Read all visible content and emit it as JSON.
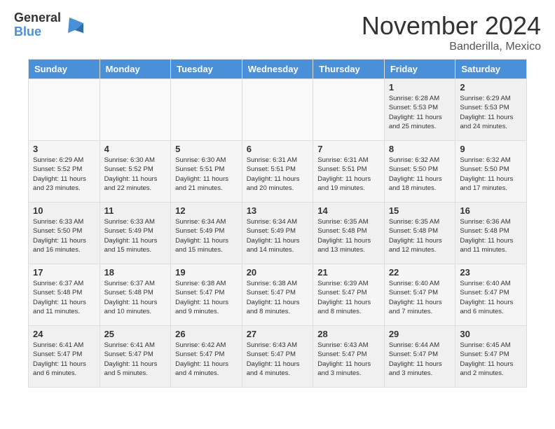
{
  "logo": {
    "general": "General",
    "blue": "Blue"
  },
  "header": {
    "month": "November 2024",
    "location": "Banderilla, Mexico"
  },
  "weekdays": [
    "Sunday",
    "Monday",
    "Tuesday",
    "Wednesday",
    "Thursday",
    "Friday",
    "Saturday"
  ],
  "weeks": [
    [
      {
        "day": "",
        "empty": true
      },
      {
        "day": "",
        "empty": true
      },
      {
        "day": "",
        "empty": true
      },
      {
        "day": "",
        "empty": true
      },
      {
        "day": "",
        "empty": true
      },
      {
        "day": "1",
        "sunrise": "Sunrise: 6:28 AM",
        "sunset": "Sunset: 5:53 PM",
        "daylight": "Daylight: 11 hours and 25 minutes."
      },
      {
        "day": "2",
        "sunrise": "Sunrise: 6:29 AM",
        "sunset": "Sunset: 5:53 PM",
        "daylight": "Daylight: 11 hours and 24 minutes."
      }
    ],
    [
      {
        "day": "3",
        "sunrise": "Sunrise: 6:29 AM",
        "sunset": "Sunset: 5:52 PM",
        "daylight": "Daylight: 11 hours and 23 minutes."
      },
      {
        "day": "4",
        "sunrise": "Sunrise: 6:30 AM",
        "sunset": "Sunset: 5:52 PM",
        "daylight": "Daylight: 11 hours and 22 minutes."
      },
      {
        "day": "5",
        "sunrise": "Sunrise: 6:30 AM",
        "sunset": "Sunset: 5:51 PM",
        "daylight": "Daylight: 11 hours and 21 minutes."
      },
      {
        "day": "6",
        "sunrise": "Sunrise: 6:31 AM",
        "sunset": "Sunset: 5:51 PM",
        "daylight": "Daylight: 11 hours and 20 minutes."
      },
      {
        "day": "7",
        "sunrise": "Sunrise: 6:31 AM",
        "sunset": "Sunset: 5:51 PM",
        "daylight": "Daylight: 11 hours and 19 minutes."
      },
      {
        "day": "8",
        "sunrise": "Sunrise: 6:32 AM",
        "sunset": "Sunset: 5:50 PM",
        "daylight": "Daylight: 11 hours and 18 minutes."
      },
      {
        "day": "9",
        "sunrise": "Sunrise: 6:32 AM",
        "sunset": "Sunset: 5:50 PM",
        "daylight": "Daylight: 11 hours and 17 minutes."
      }
    ],
    [
      {
        "day": "10",
        "sunrise": "Sunrise: 6:33 AM",
        "sunset": "Sunset: 5:50 PM",
        "daylight": "Daylight: 11 hours and 16 minutes."
      },
      {
        "day": "11",
        "sunrise": "Sunrise: 6:33 AM",
        "sunset": "Sunset: 5:49 PM",
        "daylight": "Daylight: 11 hours and 15 minutes."
      },
      {
        "day": "12",
        "sunrise": "Sunrise: 6:34 AM",
        "sunset": "Sunset: 5:49 PM",
        "daylight": "Daylight: 11 hours and 15 minutes."
      },
      {
        "day": "13",
        "sunrise": "Sunrise: 6:34 AM",
        "sunset": "Sunset: 5:49 PM",
        "daylight": "Daylight: 11 hours and 14 minutes."
      },
      {
        "day": "14",
        "sunrise": "Sunrise: 6:35 AM",
        "sunset": "Sunset: 5:48 PM",
        "daylight": "Daylight: 11 hours and 13 minutes."
      },
      {
        "day": "15",
        "sunrise": "Sunrise: 6:35 AM",
        "sunset": "Sunset: 5:48 PM",
        "daylight": "Daylight: 11 hours and 12 minutes."
      },
      {
        "day": "16",
        "sunrise": "Sunrise: 6:36 AM",
        "sunset": "Sunset: 5:48 PM",
        "daylight": "Daylight: 11 hours and 11 minutes."
      }
    ],
    [
      {
        "day": "17",
        "sunrise": "Sunrise: 6:37 AM",
        "sunset": "Sunset: 5:48 PM",
        "daylight": "Daylight: 11 hours and 11 minutes."
      },
      {
        "day": "18",
        "sunrise": "Sunrise: 6:37 AM",
        "sunset": "Sunset: 5:48 PM",
        "daylight": "Daylight: 11 hours and 10 minutes."
      },
      {
        "day": "19",
        "sunrise": "Sunrise: 6:38 AM",
        "sunset": "Sunset: 5:47 PM",
        "daylight": "Daylight: 11 hours and 9 minutes."
      },
      {
        "day": "20",
        "sunrise": "Sunrise: 6:38 AM",
        "sunset": "Sunset: 5:47 PM",
        "daylight": "Daylight: 11 hours and 8 minutes."
      },
      {
        "day": "21",
        "sunrise": "Sunrise: 6:39 AM",
        "sunset": "Sunset: 5:47 PM",
        "daylight": "Daylight: 11 hours and 8 minutes."
      },
      {
        "day": "22",
        "sunrise": "Sunrise: 6:40 AM",
        "sunset": "Sunset: 5:47 PM",
        "daylight": "Daylight: 11 hours and 7 minutes."
      },
      {
        "day": "23",
        "sunrise": "Sunrise: 6:40 AM",
        "sunset": "Sunset: 5:47 PM",
        "daylight": "Daylight: 11 hours and 6 minutes."
      }
    ],
    [
      {
        "day": "24",
        "sunrise": "Sunrise: 6:41 AM",
        "sunset": "Sunset: 5:47 PM",
        "daylight": "Daylight: 11 hours and 6 minutes."
      },
      {
        "day": "25",
        "sunrise": "Sunrise: 6:41 AM",
        "sunset": "Sunset: 5:47 PM",
        "daylight": "Daylight: 11 hours and 5 minutes."
      },
      {
        "day": "26",
        "sunrise": "Sunrise: 6:42 AM",
        "sunset": "Sunset: 5:47 PM",
        "daylight": "Daylight: 11 hours and 4 minutes."
      },
      {
        "day": "27",
        "sunrise": "Sunrise: 6:43 AM",
        "sunset": "Sunset: 5:47 PM",
        "daylight": "Daylight: 11 hours and 4 minutes."
      },
      {
        "day": "28",
        "sunrise": "Sunrise: 6:43 AM",
        "sunset": "Sunset: 5:47 PM",
        "daylight": "Daylight: 11 hours and 3 minutes."
      },
      {
        "day": "29",
        "sunrise": "Sunrise: 6:44 AM",
        "sunset": "Sunset: 5:47 PM",
        "daylight": "Daylight: 11 hours and 3 minutes."
      },
      {
        "day": "30",
        "sunrise": "Sunrise: 6:45 AM",
        "sunset": "Sunset: 5:47 PM",
        "daylight": "Daylight: 11 hours and 2 minutes."
      }
    ]
  ]
}
